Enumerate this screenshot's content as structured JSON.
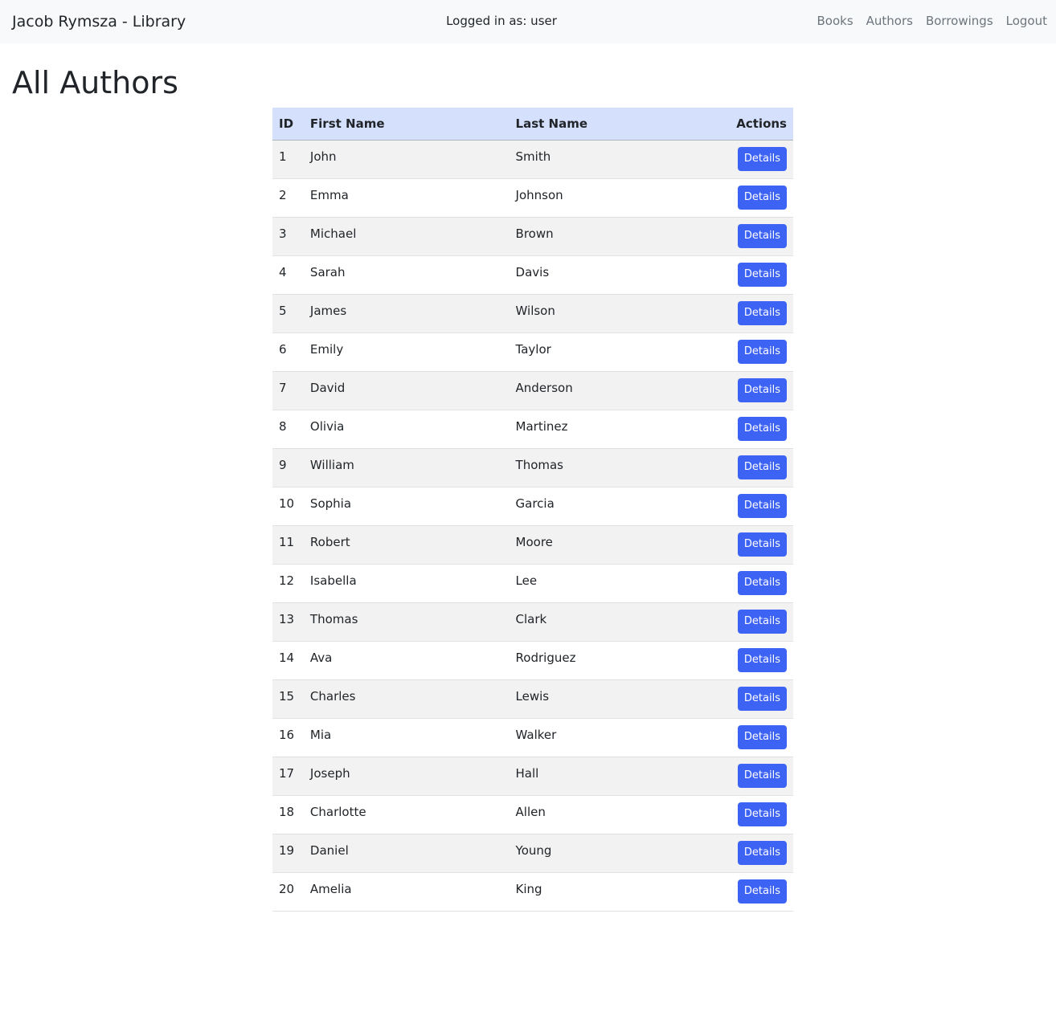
{
  "navbar": {
    "brand": "Jacob Rymsza - Library",
    "logged_in_text": "Logged in as: user",
    "links": [
      {
        "label": "Books"
      },
      {
        "label": "Authors"
      },
      {
        "label": "Borrowings"
      },
      {
        "label": "Logout"
      }
    ]
  },
  "page": {
    "title": "All Authors"
  },
  "table": {
    "headers": {
      "id": "ID",
      "first_name": "First Name",
      "last_name": "Last Name",
      "actions": "Actions"
    },
    "action_label": "Details",
    "rows": [
      {
        "id": "1",
        "first_name": "John",
        "last_name": "Smith"
      },
      {
        "id": "2",
        "first_name": "Emma",
        "last_name": "Johnson"
      },
      {
        "id": "3",
        "first_name": "Michael",
        "last_name": "Brown"
      },
      {
        "id": "4",
        "first_name": "Sarah",
        "last_name": "Davis"
      },
      {
        "id": "5",
        "first_name": "James",
        "last_name": "Wilson"
      },
      {
        "id": "6",
        "first_name": "Emily",
        "last_name": "Taylor"
      },
      {
        "id": "7",
        "first_name": "David",
        "last_name": "Anderson"
      },
      {
        "id": "8",
        "first_name": "Olivia",
        "last_name": "Martinez"
      },
      {
        "id": "9",
        "first_name": "William",
        "last_name": "Thomas"
      },
      {
        "id": "10",
        "first_name": "Sophia",
        "last_name": "Garcia"
      },
      {
        "id": "11",
        "first_name": "Robert",
        "last_name": "Moore"
      },
      {
        "id": "12",
        "first_name": "Isabella",
        "last_name": "Lee"
      },
      {
        "id": "13",
        "first_name": "Thomas",
        "last_name": "Clark"
      },
      {
        "id": "14",
        "first_name": "Ava",
        "last_name": "Rodriguez"
      },
      {
        "id": "15",
        "first_name": "Charles",
        "last_name": "Lewis"
      },
      {
        "id": "16",
        "first_name": "Mia",
        "last_name": "Walker"
      },
      {
        "id": "17",
        "first_name": "Joseph",
        "last_name": "Hall"
      },
      {
        "id": "18",
        "first_name": "Charlotte",
        "last_name": "Allen"
      },
      {
        "id": "19",
        "first_name": "Daniel",
        "last_name": "Young"
      },
      {
        "id": "20",
        "first_name": "Amelia",
        "last_name": "King"
      }
    ]
  },
  "colors": {
    "navbar_background": "#f8f9fa",
    "table_header_background": "#d5e1fc",
    "striped_row_background": "#f2f2f2",
    "button_primary": "#3d63f5",
    "nav_link_text": "#6c757d"
  }
}
